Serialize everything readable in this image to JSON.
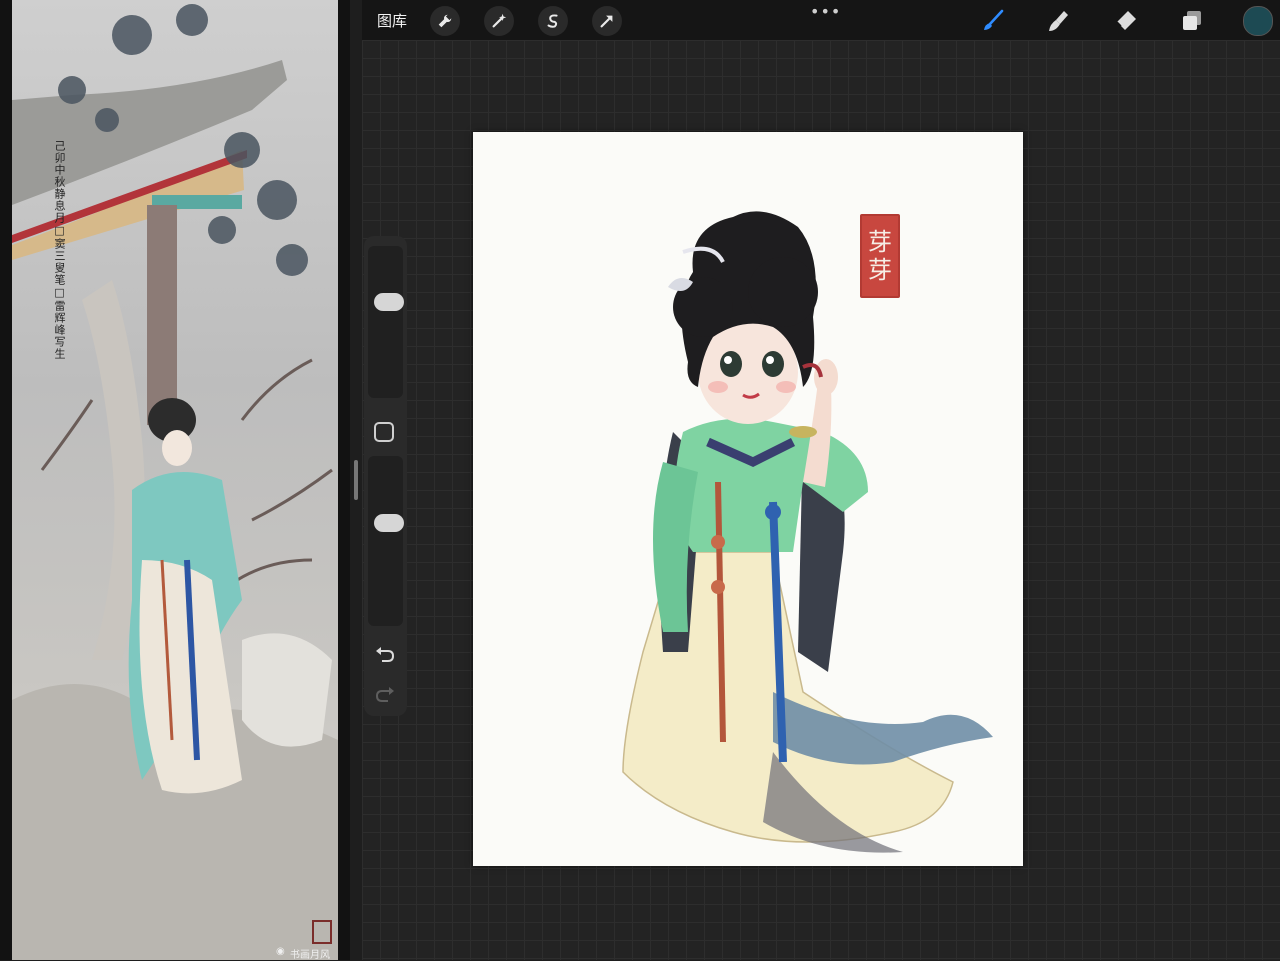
{
  "top_bar": {
    "gallery_label": "图库",
    "more_menu_icon": "ellipsis-icon",
    "left_tools": [
      "wrench-icon",
      "magic-wand-icon",
      "selection-s-icon",
      "move-arrow-icon"
    ],
    "right_tools": [
      "brush-icon",
      "smudge-icon",
      "eraser-icon",
      "layers-icon"
    ],
    "active_tool": "brush",
    "active_color": "#1d4a53"
  },
  "reference": {
    "inscription": "己卯中秋静息月□窦三叟笔□雷辉峰写生",
    "watermark": "书画月风"
  },
  "canvas": {
    "stamp_chars": [
      "芽",
      "芽"
    ]
  },
  "side_bar": {
    "brush_size_level": 0.35,
    "opacity_level": 0.38,
    "modify_icon": "square-icon",
    "undo_icon": "undo-icon",
    "redo_icon": "redo-icon"
  }
}
